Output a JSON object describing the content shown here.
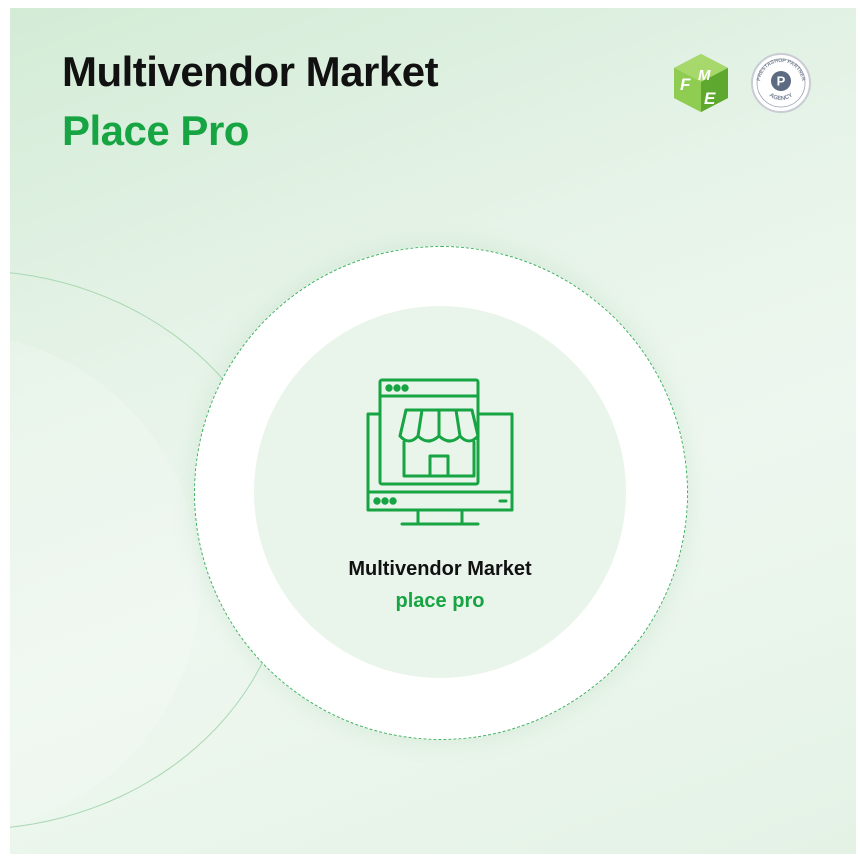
{
  "title": {
    "line1": "Multivendor Market",
    "line2": "Place Pro"
  },
  "logos": {
    "fme": {
      "icon": "fme-logo",
      "text": "FME"
    },
    "prestashop": {
      "icon": "prestashop-partner-agency-badge",
      "text": "PRESTASHOP PARTNER AGENCY"
    }
  },
  "badge": {
    "icon": "online-store-monitor-icon",
    "caption_line1": "Multivendor Market",
    "caption_line2": "place pro"
  },
  "colors": {
    "accent": "#17a443",
    "heading": "#111111",
    "background": "#e6f3e8",
    "ring": "#ffffff"
  }
}
